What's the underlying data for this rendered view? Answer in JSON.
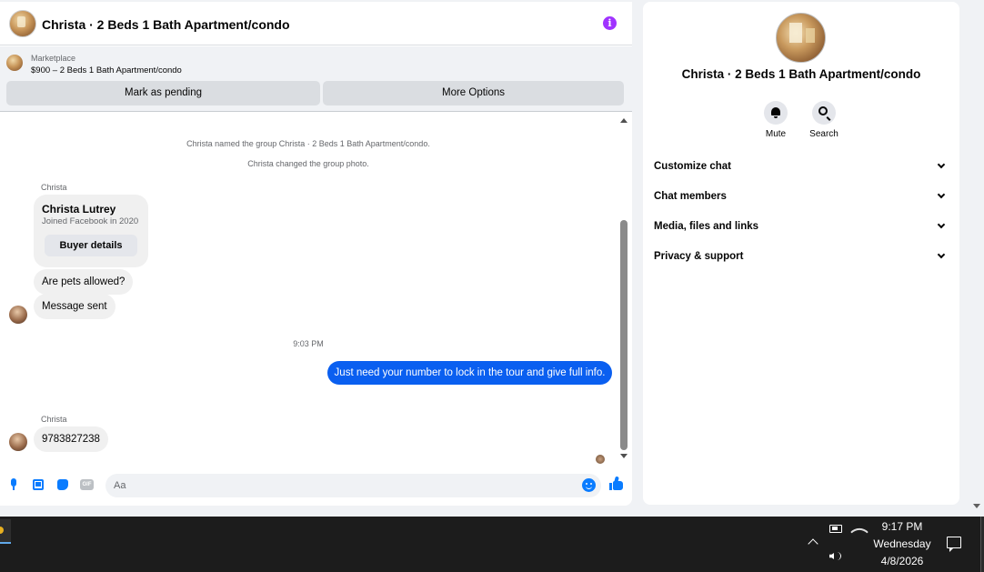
{
  "header": {
    "title": "Christa · 2 Beds 1 Bath Apartment/condo"
  },
  "listing": {
    "category": "Marketplace",
    "price_title": "$900 – 2 Beds 1 Bath Apartment/condo",
    "mark_pending_label": "Mark as pending",
    "more_options_label": "More Options"
  },
  "messages": {
    "system_1": "Christa named the group Christa · 2 Beds 1 Bath Apartment/condo.",
    "system_2": "Christa changed the group photo.",
    "sender_1": "Christa",
    "profile_card": {
      "name": "Christa Lutrey",
      "subtitle": "Joined Facebook in 2020",
      "button_label": "Buyer details"
    },
    "incoming_1": "Are pets allowed?",
    "incoming_2": "Message sent",
    "timestamp": "9:03 PM",
    "outgoing_1": "Just need your number to lock in the tour and give full info.",
    "sender_2": "Christa",
    "incoming_3": "9783827238"
  },
  "composer": {
    "placeholder": "Aa"
  },
  "side_panel": {
    "title": "Christa · 2 Beds 1 Bath Apartment/condo",
    "actions": [
      {
        "label": "Mute",
        "icon": "bell-icon"
      },
      {
        "label": "Search",
        "icon": "search-icon"
      }
    ],
    "sections": [
      {
        "label": "Customize chat"
      },
      {
        "label": "Chat members"
      },
      {
        "label": "Media, files and links"
      },
      {
        "label": "Privacy & support"
      }
    ]
  },
  "taskbar": {
    "time": "9:17 PM",
    "day": "Wednesday",
    "date": "4/8/2026"
  },
  "colors": {
    "accent_blue": "#0a7cff",
    "outgoing_bubble": "#0a5ff0",
    "info_purple": "#a033ff",
    "taskbar_bg": "#1c1c1c"
  }
}
